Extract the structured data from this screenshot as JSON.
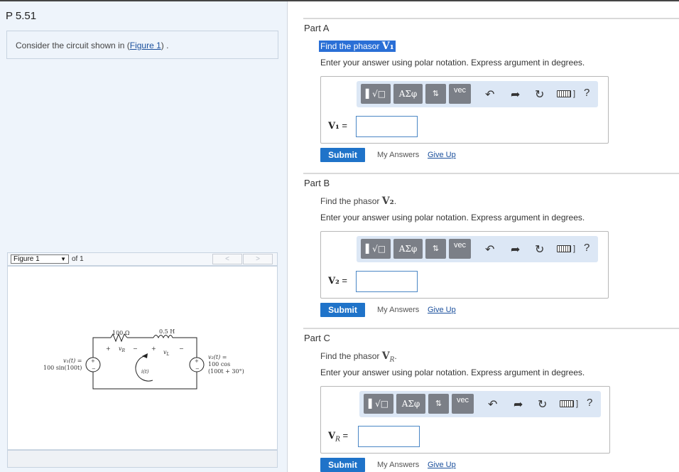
{
  "problem": {
    "title": "P 5.51",
    "intro_before": "Consider the circuit shown in (",
    "intro_link": "Figure 1",
    "intro_after": ") ."
  },
  "figure": {
    "selected": "Figure 1",
    "of_text": "of 1",
    "prev": "<",
    "next": ">",
    "labels": {
      "r": "100 Ω",
      "l": "0.5 H",
      "vr": "v",
      "vr_sub": "R",
      "vl": "v",
      "vl_sub": "L",
      "plus": "+",
      "minus": "−",
      "v1a": "v₁(t) =",
      "v1b": "100 sin(100t)",
      "it": "i(t)",
      "v2a": "v₂(t) =",
      "v2b": "100 cos",
      "v2c": "(100t + 30°)"
    }
  },
  "toolbar": {
    "b1": "▌√□",
    "b2": "AΣφ",
    "b3": "⇅",
    "b4": "vec",
    "undo": "↶",
    "redo": "➦",
    "reset": "↻",
    "help": "?"
  },
  "parts": [
    {
      "title": "Part A",
      "find_text": "Find the phasor ",
      "find_sym": "V₁",
      "instruction": "Enter your answer using polar notation. Express argument in degrees.",
      "var_sym": "V₁",
      "eq": " ="
    },
    {
      "title": "Part B",
      "find_text": "Find the phasor ",
      "find_sym": "V₂",
      "find_end": ".",
      "instruction": "Enter your answer using polar notation. Express argument in degrees.",
      "var_sym": "V₂",
      "eq": " ="
    },
    {
      "title": "Part C",
      "find_text": "Find the phasor ",
      "find_sym": "V",
      "find_sub": "R",
      "find_end": ".",
      "instruction": "Enter your answer using polar notation. Express argument in degrees.",
      "var_sym": "V",
      "var_sub": "R",
      "eq": " ="
    }
  ],
  "actions": {
    "submit": "Submit",
    "my_answers": "My Answers",
    "give_up": "Give Up"
  }
}
